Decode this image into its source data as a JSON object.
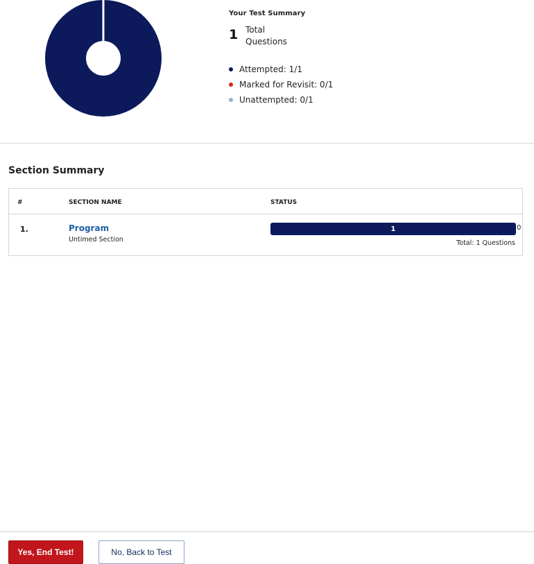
{
  "summary": {
    "title": "Your Test Summary",
    "total_count": "1",
    "total_label_line1": "Total",
    "total_label_line2": "Questions",
    "legend": [
      {
        "label": "Attempted: 1/1",
        "color": "#0c1a5c"
      },
      {
        "label": "Marked for Revisit: 0/1",
        "color": "#e0201d"
      },
      {
        "label": "Unattempted: 0/1",
        "color": "#8fb4cc"
      }
    ]
  },
  "donut": {
    "color": "#0c1a5c",
    "attempted_fraction": 1.0
  },
  "section_summary": {
    "title": "Section Summary",
    "columns": [
      "#",
      "SECTION NAME",
      "STATUS"
    ],
    "rows": [
      {
        "index": "1.",
        "name": "Program",
        "subtitle": "Untimed Section",
        "attempted": "1",
        "remaining": "0",
        "progress": 1.0,
        "total_text": "Total: 1 Questions"
      }
    ]
  },
  "footer": {
    "end_label": "Yes, End Test!",
    "back_label": "No, Back to Test",
    "end_color": "#c0161c"
  }
}
